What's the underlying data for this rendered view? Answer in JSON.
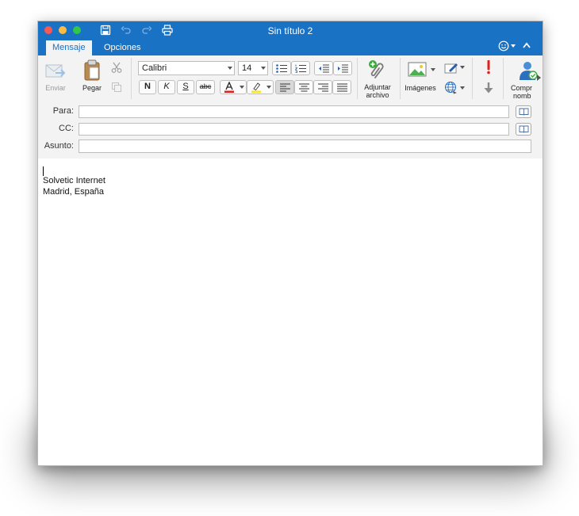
{
  "window": {
    "title": "Sin título 2"
  },
  "tabs": [
    {
      "label": "Mensaje"
    },
    {
      "label": "Opciones"
    }
  ],
  "ribbon": {
    "send_label": "Enviar",
    "paste_label": "Pegar",
    "font_name": "Calibri",
    "font_size": "14",
    "bold_label": "N",
    "italic_label": "K",
    "underline_label": "S",
    "strike_label": "abc",
    "attach_label_line1": "Adjuntar",
    "attach_label_line2": "archivo",
    "images_label": "Imágenes",
    "check_names_line1": "Compr",
    "check_names_line2": "nomb"
  },
  "address": {
    "to_label": "Para:",
    "cc_label": "CC:",
    "subject_label": "Asunto:",
    "to_value": "",
    "cc_value": "",
    "subject_value": ""
  },
  "body": {
    "line1": "Solvetic Internet",
    "line2": "Madrid, España"
  },
  "colors": {
    "titlebar": "#1a72c4",
    "ribbon": "#f3f3f3",
    "close": "#fc5753",
    "minimize": "#fdbc40",
    "zoom": "#33c748"
  }
}
